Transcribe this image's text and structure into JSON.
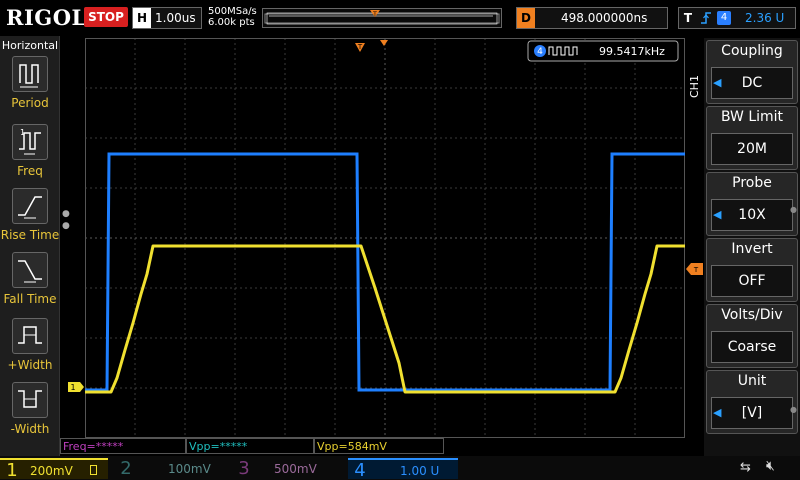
{
  "header": {
    "logo": "RIGOL",
    "run_status": "STOP",
    "horizontal_label": "H",
    "horizontal_value": "1.00us",
    "sample_rate": "500MSa/s",
    "memory_depth": "6.00k pts",
    "delay_label": "D",
    "delay_value": "498.000000ns",
    "trigger_label": "T",
    "trigger_source": "4",
    "trigger_level": "2.36 U"
  },
  "left_menu": {
    "title": "Horizontal",
    "items": [
      {
        "label": "Period",
        "icon": "period-icon"
      },
      {
        "label": "Freq",
        "icon": "freq-icon"
      },
      {
        "label": "Rise Time",
        "icon": "rise-time-icon"
      },
      {
        "label": "Fall Time",
        "icon": "fall-time-icon"
      },
      {
        "label": "+Width",
        "icon": "positive-width-icon"
      },
      {
        "label": "-Width",
        "icon": "negative-width-icon"
      }
    ]
  },
  "freq_counter": {
    "channel": "4",
    "value": "99.5417kHz"
  },
  "ch_tag": "CH1",
  "right_menu": [
    {
      "title": "Coupling",
      "value": "DC"
    },
    {
      "title": "BW Limit",
      "value": "20M"
    },
    {
      "title": "Probe",
      "value": "10X"
    },
    {
      "title": "Invert",
      "value": "OFF"
    },
    {
      "title": "Volts/Div",
      "value": "Coarse"
    },
    {
      "title": "Unit",
      "value": "[V]"
    }
  ],
  "measurements": [
    {
      "text": "Freq=*****",
      "color": "#c040c0"
    },
    {
      "text": "Vpp=*****",
      "color": "#20c0c0"
    },
    {
      "text": "Vpp=584mV",
      "color": "#e8d030"
    }
  ],
  "channels": [
    {
      "num": "1",
      "value": "200mV",
      "color": "#f0e030",
      "active": true
    },
    {
      "num": "2",
      "value": "100mV",
      "color": "#40a0a0",
      "active": false
    },
    {
      "num": "3",
      "value": "500mV",
      "color": "#b040b0",
      "active": false
    },
    {
      "num": "4",
      "value": "1.00 U",
      "color": "#2a8fff",
      "active": true
    }
  ],
  "colors": {
    "ch1": "#f0e030",
    "ch4": "#1e7fff",
    "trigger_marker": "#f08020",
    "accent": "#2aa0ff"
  }
}
